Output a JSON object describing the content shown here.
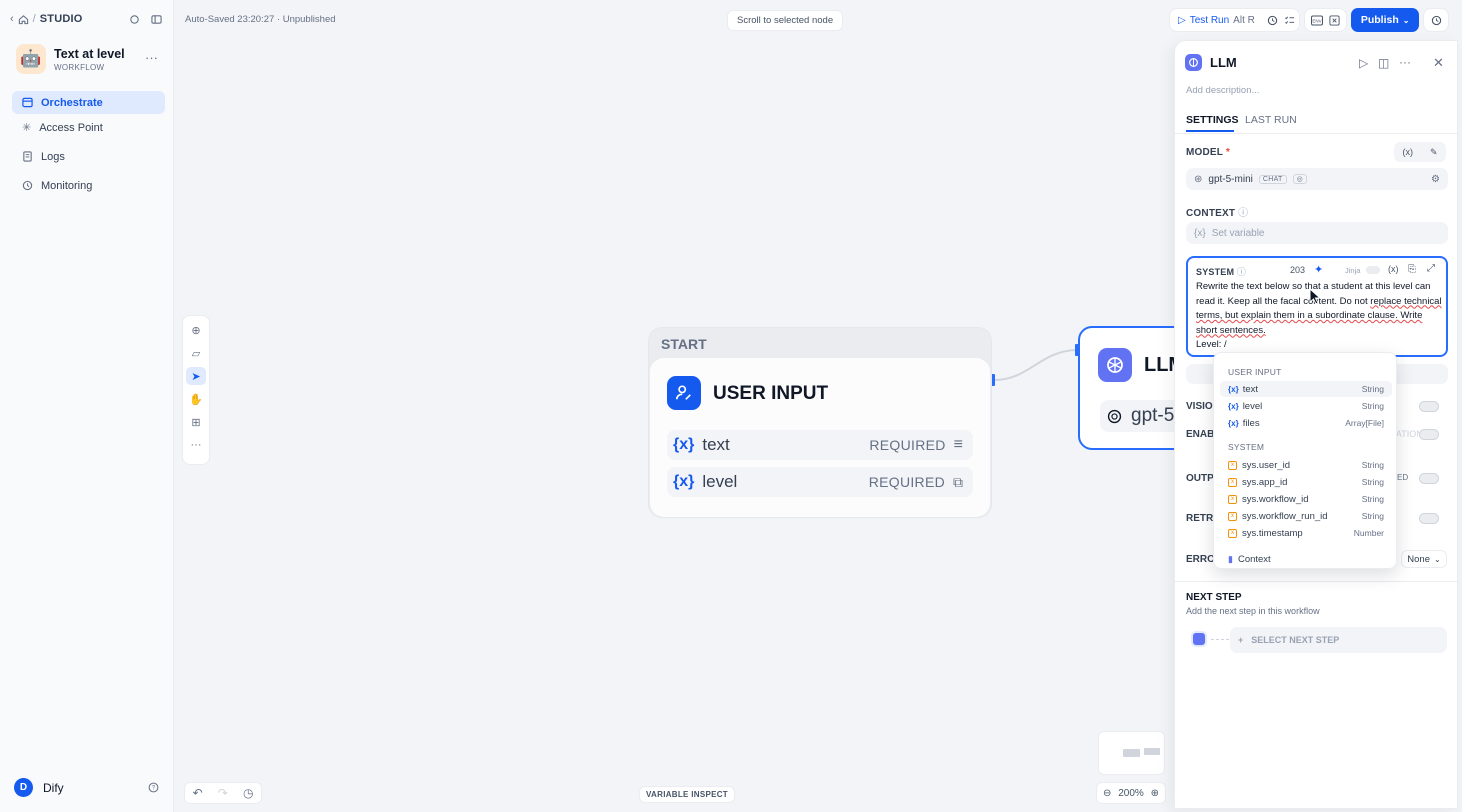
{
  "breadcrumb": {
    "section": "STUDIO"
  },
  "app": {
    "emoji": "🤖",
    "name": "Text at level",
    "type": "WORKFLOW"
  },
  "nav": [
    {
      "label": "Orchestrate"
    },
    {
      "label": "Access Point"
    },
    {
      "label": "Logs"
    },
    {
      "label": "Monitoring"
    }
  ],
  "user": {
    "initial": "D",
    "name": "Dify"
  },
  "header": {
    "status": "Auto-Saved 23:20:27 · Unpublished",
    "scroll_hint": "Scroll to selected node",
    "test_run": "Test Run",
    "test_run_shortcut": "Alt R",
    "publish": "Publish"
  },
  "start_node": {
    "label": "START",
    "title": "USER INPUT",
    "variables": [
      {
        "name": "text",
        "required": "REQUIRED"
      },
      {
        "name": "level",
        "required": "REQUIRED"
      }
    ]
  },
  "llm_node": {
    "title": "LLM",
    "model": "gpt-5-mini"
  },
  "bottom": {
    "variable_inspect": "VARIABLE INSPECT",
    "zoom": "200%"
  },
  "panel": {
    "title": "LLM",
    "description_placeholder": "Add description...",
    "tabs": [
      "SETTINGS",
      "LAST RUN"
    ],
    "model_label": "MODEL",
    "required_mark": "*",
    "model_name": "gpt-5-mini",
    "model_badge": "CHAT",
    "context_label": "CONTEXT",
    "context_placeholder": "Set variable",
    "system_label": "SYSTEM",
    "system_count": "203",
    "jinja": "Jinja",
    "system_text_1": "Rewrite the text below so that a student at this level can read it. Keep all the fa",
    "system_text_2": "cal content. Do not ",
    "system_text_3": "replace technical terms, but explain them in a subordinate clause. Write short sentences.",
    "system_text_4": "Level: /",
    "vision_label": "VISIO",
    "enable_label": "ENAB",
    "enable_tail": "REASONING TAG SEPARATION",
    "output_label": "OUTP",
    "output_tail": "ED",
    "retry_label": "RETRY",
    "error_label": "ERROI",
    "error_value": "None",
    "next_step_label": "NEXT STEP",
    "next_step_desc": "Add the next step in this workflow",
    "select_next": "SELECT NEXT STEP"
  },
  "dropdown": {
    "user_input_header": "USER INPUT",
    "user_vars": [
      {
        "name": "text",
        "type": "String"
      },
      {
        "name": "level",
        "type": "String"
      },
      {
        "name": "files",
        "type": "Array[File]"
      }
    ],
    "system_header": "SYSTEM",
    "system_vars": [
      {
        "name": "sys.user_id",
        "type": "String"
      },
      {
        "name": "sys.app_id",
        "type": "String"
      },
      {
        "name": "sys.workflow_id",
        "type": "String"
      },
      {
        "name": "sys.workflow_run_id",
        "type": "String"
      },
      {
        "name": "sys.timestamp",
        "type": "Number"
      }
    ],
    "context_item": "Context"
  }
}
